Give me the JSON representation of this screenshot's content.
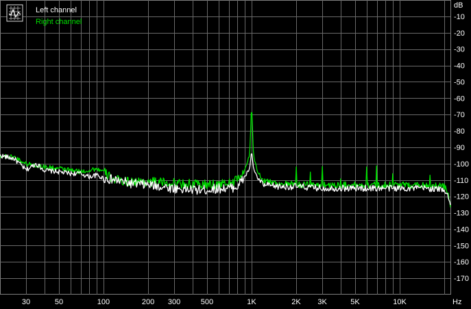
{
  "chart_data": {
    "type": "line",
    "title": "",
    "xlabel": "Hz",
    "ylabel": "dB",
    "x_scale": "log",
    "xlim": [
      20,
      22000
    ],
    "ylim": [
      -180,
      0
    ],
    "grid": true,
    "legend_position": "top-left",
    "x_ticks": [
      {
        "value": 30,
        "label": "30"
      },
      {
        "value": 50,
        "label": "50"
      },
      {
        "value": 100,
        "label": "100"
      },
      {
        "value": 200,
        "label": "200"
      },
      {
        "value": 300,
        "label": "300"
      },
      {
        "value": 500,
        "label": "500"
      },
      {
        "value": 1000,
        "label": "1K"
      },
      {
        "value": 2000,
        "label": "2K"
      },
      {
        "value": 3000,
        "label": "3K"
      },
      {
        "value": 5000,
        "label": "5K"
      },
      {
        "value": 10000,
        "label": "10K"
      }
    ],
    "y_ticks": [
      {
        "value": -10,
        "label": "-10"
      },
      {
        "value": -20,
        "label": "-20"
      },
      {
        "value": -30,
        "label": "-30"
      },
      {
        "value": -40,
        "label": "-40"
      },
      {
        "value": -50,
        "label": "-50"
      },
      {
        "value": -60,
        "label": "-60"
      },
      {
        "value": -70,
        "label": "-70"
      },
      {
        "value": -80,
        "label": "-80"
      },
      {
        "value": -90,
        "label": "-90"
      },
      {
        "value": -100,
        "label": "-100"
      },
      {
        "value": -110,
        "label": "-110"
      },
      {
        "value": -120,
        "label": "-120"
      },
      {
        "value": -130,
        "label": "-130"
      },
      {
        "value": -140,
        "label": "-140"
      },
      {
        "value": -150,
        "label": "-150"
      },
      {
        "value": -160,
        "label": "-160"
      },
      {
        "value": -170,
        "label": "-170"
      }
    ],
    "series": [
      {
        "name": "Left channel",
        "color": "#ffffff",
        "points": [
          [
            20,
            -95
          ],
          [
            25,
            -97
          ],
          [
            30,
            -104
          ],
          [
            35,
            -100
          ],
          [
            40,
            -104
          ],
          [
            50,
            -105
          ],
          [
            60,
            -106
          ],
          [
            70,
            -106
          ],
          [
            80,
            -108
          ],
          [
            90,
            -107
          ],
          [
            100,
            -109
          ],
          [
            120,
            -110
          ],
          [
            150,
            -112
          ],
          [
            200,
            -113
          ],
          [
            250,
            -114
          ],
          [
            300,
            -115
          ],
          [
            400,
            -116
          ],
          [
            500,
            -116
          ],
          [
            600,
            -115
          ],
          [
            700,
            -115
          ],
          [
            800,
            -114
          ],
          [
            900,
            -108
          ],
          [
            970,
            -103
          ],
          [
            1000,
            -92
          ],
          [
            1030,
            -103
          ],
          [
            1100,
            -109
          ],
          [
            1200,
            -113
          ],
          [
            1500,
            -114
          ],
          [
            2000,
            -114
          ],
          [
            3000,
            -115
          ],
          [
            4000,
            -115
          ],
          [
            5000,
            -115
          ],
          [
            7000,
            -115
          ],
          [
            10000,
            -115
          ],
          [
            15000,
            -115
          ],
          [
            20000,
            -116
          ],
          [
            21000,
            -118
          ],
          [
            22000,
            -126
          ]
        ]
      },
      {
        "name": "Right channel",
        "color": "#00e000",
        "points": [
          [
            20,
            -95
          ],
          [
            25,
            -96
          ],
          [
            30,
            -100
          ],
          [
            40,
            -102
          ],
          [
            50,
            -103
          ],
          [
            60,
            -104
          ],
          [
            70,
            -105
          ],
          [
            80,
            -104
          ],
          [
            90,
            -103
          ],
          [
            100,
            -105
          ],
          [
            110,
            -108
          ],
          [
            120,
            -110
          ],
          [
            150,
            -111
          ],
          [
            200,
            -111
          ],
          [
            300,
            -112
          ],
          [
            500,
            -113
          ],
          [
            700,
            -112
          ],
          [
            800,
            -110
          ],
          [
            900,
            -104
          ],
          [
            970,
            -95
          ],
          [
            1000,
            -63
          ],
          [
            1030,
            -95
          ],
          [
            1100,
            -105
          ],
          [
            1200,
            -110
          ],
          [
            1500,
            -112
          ],
          [
            2000,
            -113
          ],
          [
            3000,
            -113
          ],
          [
            5000,
            -113
          ],
          [
            7000,
            -113
          ],
          [
            10000,
            -113
          ],
          [
            15000,
            -113
          ],
          [
            20000,
            -114
          ],
          [
            21000,
            -117
          ],
          [
            22000,
            -125
          ]
        ]
      }
    ]
  }
}
